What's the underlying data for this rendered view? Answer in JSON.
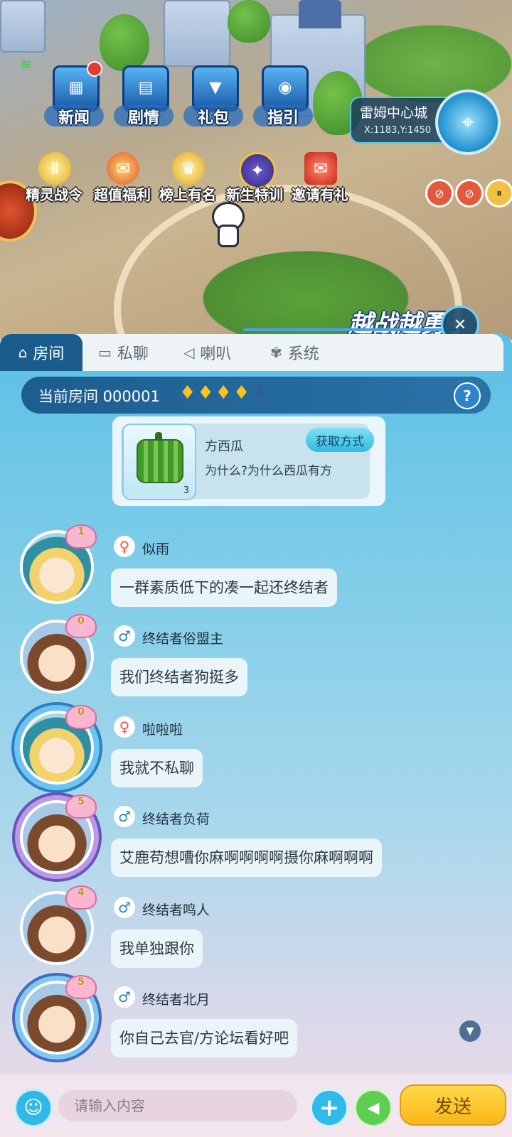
{
  "scene": {
    "top_buttons": [
      {
        "label": "新闻",
        "icon": "news-icon"
      },
      {
        "label": "剧情",
        "icon": "story-icon"
      },
      {
        "label": "礼包",
        "icon": "gift-pack-icon"
      },
      {
        "label": "指引",
        "icon": "guide-icon"
      }
    ],
    "event_buttons": [
      {
        "label": "精灵战令",
        "icon": "battle-pass-icon"
      },
      {
        "label": "超值福利",
        "icon": "welfare-icon"
      },
      {
        "label": "榜上有名",
        "icon": "ranking-icon"
      },
      {
        "label": "新生特训",
        "icon": "training-icon"
      },
      {
        "label": "邀请有礼",
        "icon": "invite-icon"
      }
    ],
    "location": {
      "city": "雷姆中心城",
      "coords": "X:1183,Y:1450"
    },
    "banner": "越战越勇"
  },
  "chat": {
    "tabs": [
      {
        "label": "房间",
        "icon": "home-icon",
        "active": true
      },
      {
        "label": "私聊",
        "icon": "private-chat-icon",
        "active": false
      },
      {
        "label": "喇叭",
        "icon": "horn-icon",
        "active": false
      },
      {
        "label": "系统",
        "icon": "system-icon",
        "active": false
      }
    ],
    "room": {
      "label": "当前房间 000001",
      "heat_level": 4,
      "heat_max": 5
    },
    "item_card": {
      "name": "方西瓜",
      "description": "为什么?为什么西瓜有方",
      "quantity": "3",
      "action": "获取方式"
    },
    "messages": [
      {
        "level": "1",
        "gender": "female",
        "user": "似雨",
        "text": "一群素质低下的凑一起还终结者"
      },
      {
        "level": "0",
        "gender": "male",
        "user": "终结者俗盟主",
        "text": "我们终结者狗挺多"
      },
      {
        "level": "0",
        "gender": "female",
        "user": "啦啦啦",
        "text": "我就不私聊"
      },
      {
        "level": "5",
        "gender": "male",
        "user": "终结者负荷",
        "text": "艾鹿苟想嘈你麻啊啊啊啊摄你麻啊啊啊"
      },
      {
        "level": "4",
        "gender": "male",
        "user": "终结者鸣人",
        "text": "我单独跟你"
      },
      {
        "level": "5",
        "gender": "male",
        "user": "终结者北月",
        "text": "你自己去官/方论坛看好吧"
      }
    ]
  },
  "input": {
    "placeholder": "请输入内容",
    "value": "",
    "send_label": "发送"
  },
  "colors": {
    "accent": "#1a5d8d",
    "send": "#fcc52c",
    "panel_top": "#5bc0e6",
    "panel_bottom": "#f0d9e4"
  }
}
